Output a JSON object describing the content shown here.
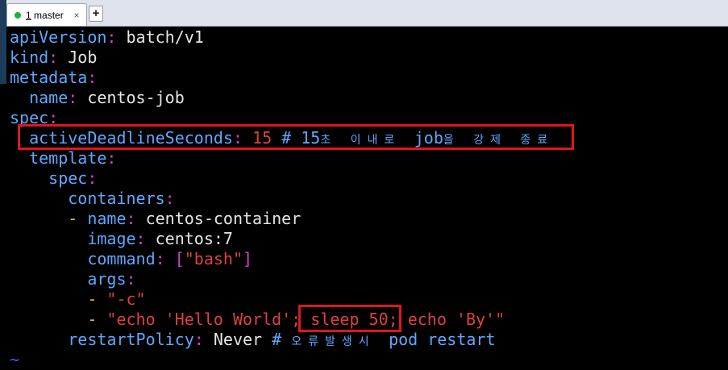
{
  "tab": {
    "number": "1",
    "label": " master",
    "close": "×"
  },
  "newtab": "+",
  "edge_strip_text": "a\na\nc\ne",
  "code": {
    "l1": {
      "key": "apiVersion",
      "colon": ":",
      "val": " batch/v1"
    },
    "l2": {
      "key": "kind",
      "colon": ":",
      "val": " Job"
    },
    "l3": {
      "key": "metadata",
      "colon": ":"
    },
    "l4": {
      "indent": "  ",
      "key": "name",
      "colon": ":",
      "val": " centos-job"
    },
    "l5": {
      "key": "spec",
      "colon": ":"
    },
    "l6": {
      "indent": "  ",
      "key": "activeDeadlineSeconds",
      "colon": ":",
      "num": " 15",
      "comment": " # 15",
      "ko1": "초 이내로 ",
      "comment2": "job",
      "ko2": "을 강제 종료"
    },
    "l7": {
      "indent": "  ",
      "key": "template",
      "colon": ":"
    },
    "l8": {
      "indent": "    ",
      "key": "spec",
      "colon": ":"
    },
    "l9": {
      "indent": "      ",
      "key": "containers",
      "colon": ":"
    },
    "l10": {
      "indent": "      ",
      "dash": "- ",
      "key": "name",
      "colon": ":",
      "val": " centos-container"
    },
    "l11": {
      "indent": "        ",
      "key": "image",
      "colon": ":",
      "val": " centos:7"
    },
    "l12": {
      "indent": "        ",
      "key": "command",
      "colon": ":",
      "b1": " [",
      "str": "\"bash\"",
      "b2": "]"
    },
    "l13": {
      "indent": "        ",
      "key": "args",
      "colon": ":"
    },
    "l14": {
      "indent": "        ",
      "dash": "- ",
      "str": "\"-c\""
    },
    "l15": {
      "indent": "        ",
      "dash": "- ",
      "str": "\"echo 'Hello World'; sleep 50; echo 'By'\""
    },
    "l16": {
      "indent": "      ",
      "key": "restartPolicy",
      "colon": ":",
      "val": " Never",
      "comment": " # ",
      "ko": "오류발생시 ",
      "comment2": "pod restart"
    },
    "l17": {
      "tilde": "~"
    }
  }
}
